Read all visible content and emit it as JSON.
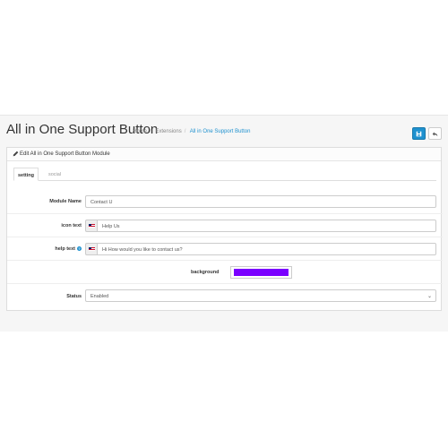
{
  "header": {
    "title": "All in One Support Button",
    "breadcrumb": [
      "Home",
      "Extensions",
      "All in One Support Button"
    ],
    "save_icon": "save-icon",
    "back_icon": "reply-icon"
  },
  "panel": {
    "heading": "Edit All in One Support Button Module",
    "heading_icon": "pencil-icon"
  },
  "tabs": [
    {
      "label": "setting"
    },
    {
      "label": "social"
    }
  ],
  "form": {
    "module_name": {
      "label": "Module Name",
      "value": "Contact U"
    },
    "icon_text": {
      "label": "icon text",
      "value": "Help Us"
    },
    "help_text": {
      "label": "help text",
      "value": "Hi How would you like to contact us?"
    },
    "background": {
      "label": "background",
      "color": "#7a00ff"
    },
    "status": {
      "label": "Status",
      "value": "Enabled"
    }
  },
  "colors": {
    "primary": "#1e91cf",
    "background_swatch": "#7a00ff"
  }
}
